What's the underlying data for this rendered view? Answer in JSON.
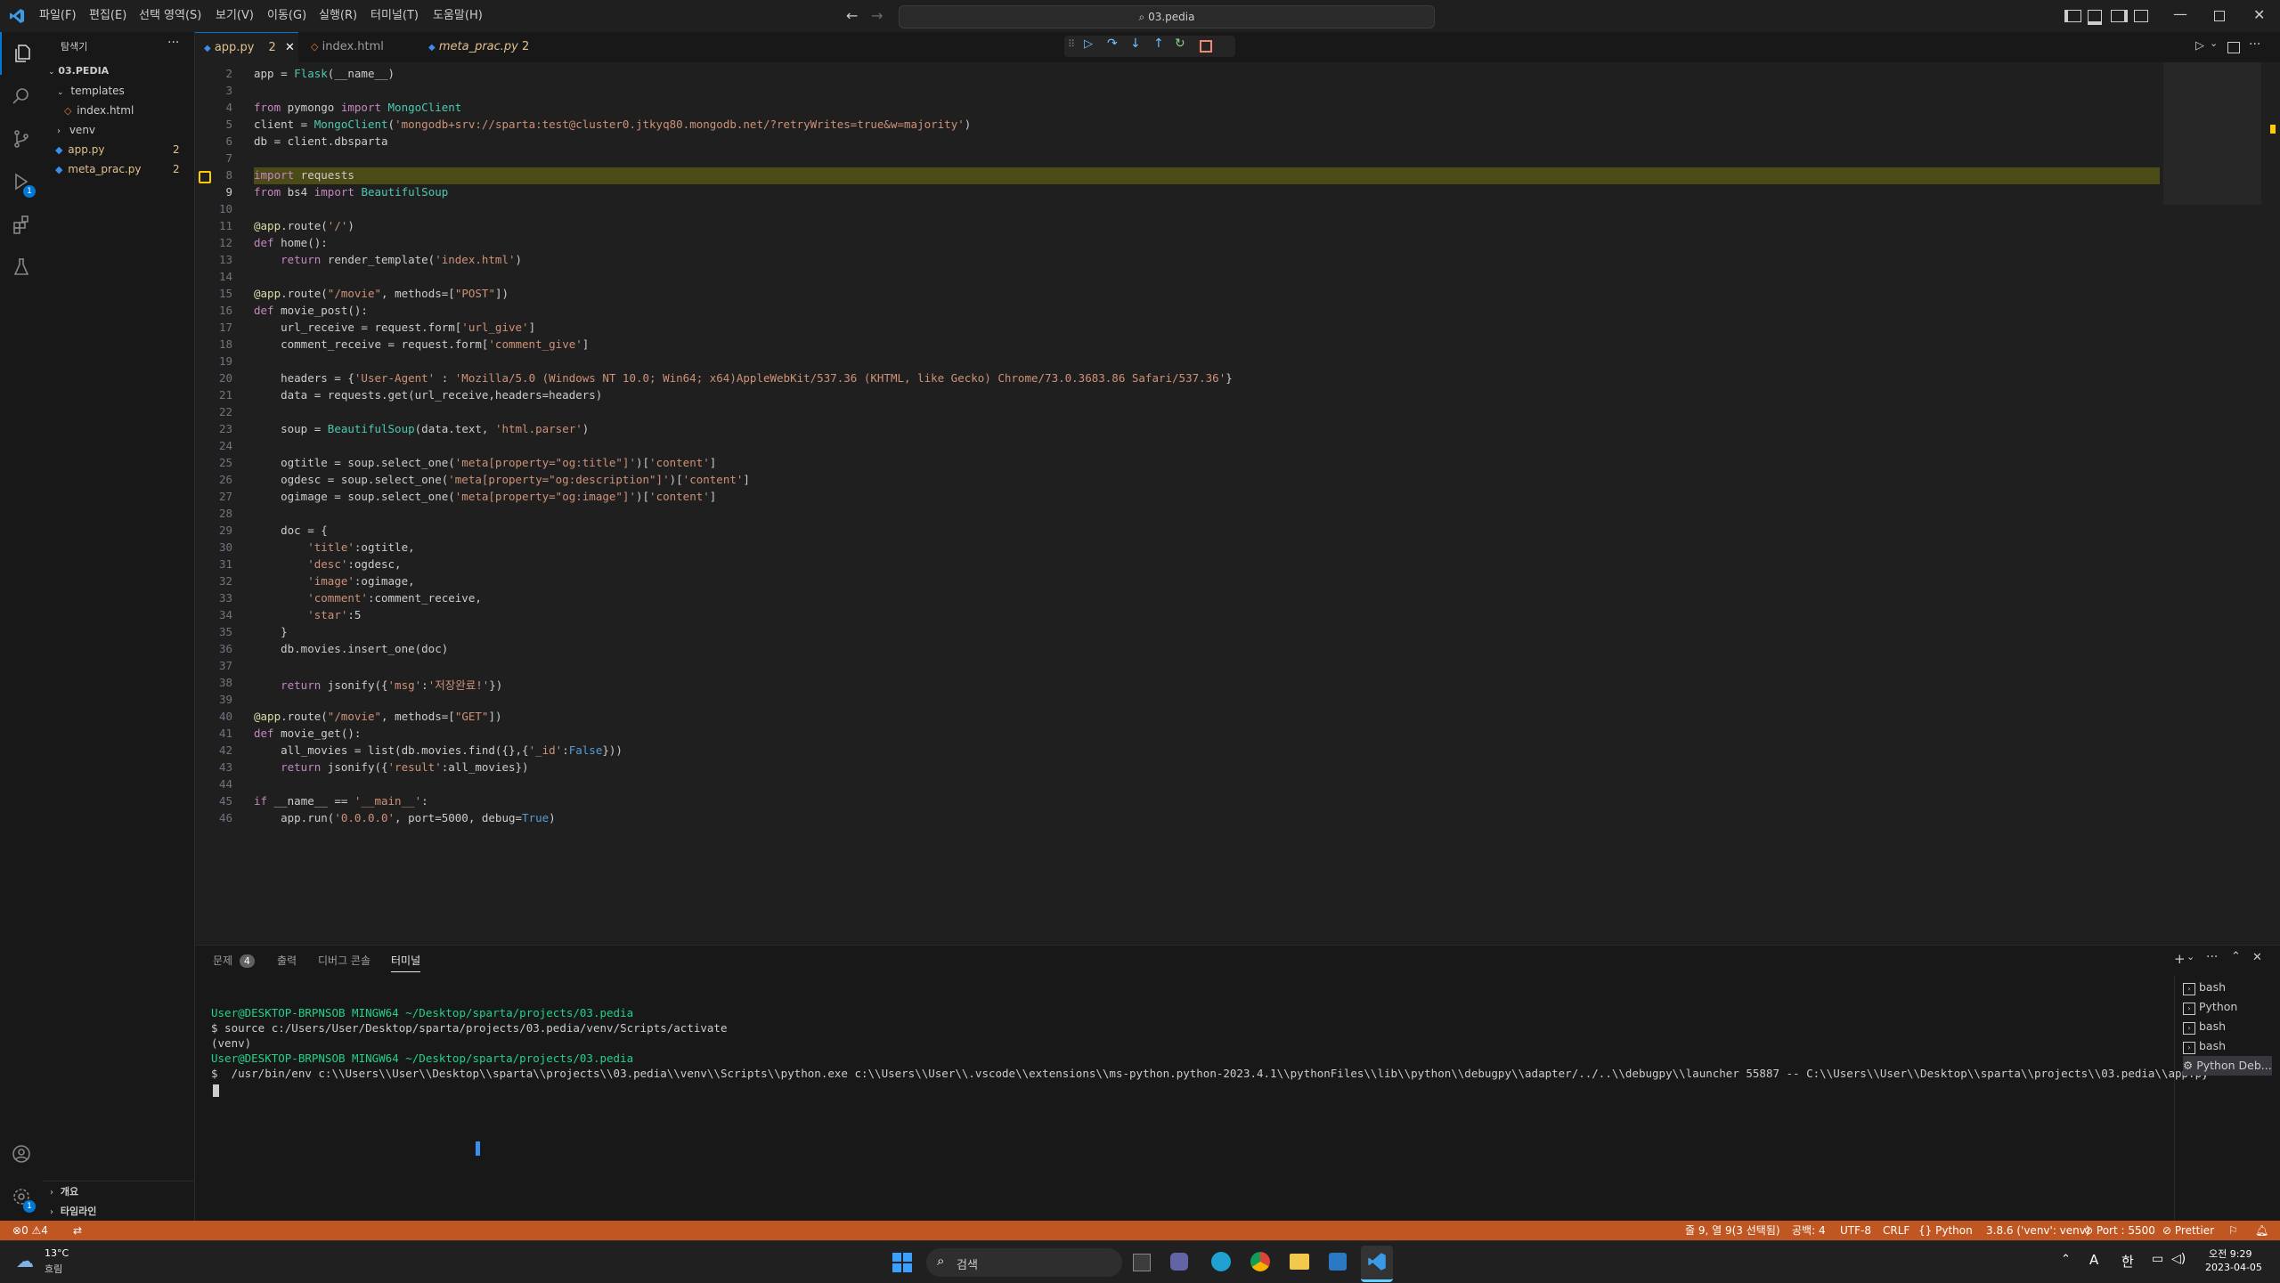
{
  "colors": {
    "accent": "#0078d4",
    "statusbar": "#c05621",
    "modified": "#e2c08d",
    "breakpoint": "#ffcc00"
  },
  "menu": [
    "파일(F)",
    "편집(E)",
    "선택 영역(S)",
    "보기(V)",
    "이동(G)",
    "실행(R)",
    "터미널(T)",
    "도움말(H)"
  ],
  "search": {
    "label": "03.pedia"
  },
  "sidebar": {
    "title": "탐색기",
    "folder": "03.PEDIA",
    "items": [
      {
        "label": "templates",
        "type": "folder-open"
      },
      {
        "label": "index.html",
        "type": "html"
      },
      {
        "label": "venv",
        "type": "folder"
      },
      {
        "label": "app.py",
        "type": "py",
        "badge": "2"
      },
      {
        "label": "meta_prac.py",
        "type": "py",
        "badge": "2"
      }
    ],
    "outline": "개요",
    "timeline": "타임라인"
  },
  "tabs": [
    {
      "label": "app.py",
      "badge": "2",
      "active": true
    },
    {
      "label": "index.html",
      "badge": ""
    },
    {
      "label": "meta_prac.py",
      "badge": "2"
    }
  ],
  "code": [
    {
      "n": "2",
      "t": "app = Flask(__name__)"
    },
    {
      "n": "3",
      "t": ""
    },
    {
      "n": "4",
      "t": "from pymongo import MongoClient"
    },
    {
      "n": "5",
      "t": "client = MongoClient('mongodb+srv://sparta:test@cluster0.jtkyq80.mongodb.net/?retryWrites=true&w=majority')"
    },
    {
      "n": "6",
      "t": "db = client.dbsparta"
    },
    {
      "n": "7",
      "t": ""
    },
    {
      "n": "8",
      "t": "import requests"
    },
    {
      "n": "9",
      "t": "from bs4 import BeautifulSoup"
    },
    {
      "n": "10",
      "t": ""
    },
    {
      "n": "11",
      "t": "@app.route('/')"
    },
    {
      "n": "12",
      "t": "def home():"
    },
    {
      "n": "13",
      "t": "    return render_template('index.html')"
    },
    {
      "n": "14",
      "t": ""
    },
    {
      "n": "15",
      "t": "@app.route(\"/movie\", methods=[\"POST\"])"
    },
    {
      "n": "16",
      "t": "def movie_post():"
    },
    {
      "n": "17",
      "t": "    url_receive = request.form['url_give']"
    },
    {
      "n": "18",
      "t": "    comment_receive = request.form['comment_give']"
    },
    {
      "n": "19",
      "t": ""
    },
    {
      "n": "20",
      "t": "    headers = {'User-Agent' : 'Mozilla/5.0 (Windows NT 10.0; Win64; x64)AppleWebKit/537.36 (KHTML, like Gecko) Chrome/73.0.3683.86 Safari/537.36'}"
    },
    {
      "n": "21",
      "t": "    data = requests.get(url_receive,headers=headers)"
    },
    {
      "n": "22",
      "t": ""
    },
    {
      "n": "23",
      "t": "    soup = BeautifulSoup(data.text, 'html.parser')"
    },
    {
      "n": "24",
      "t": ""
    },
    {
      "n": "25",
      "t": "    ogtitle = soup.select_one('meta[property=\"og:title\"]')['content']"
    },
    {
      "n": "26",
      "t": "    ogdesc = soup.select_one('meta[property=\"og:description\"]')['content']"
    },
    {
      "n": "27",
      "t": "    ogimage = soup.select_one('meta[property=\"og:image\"]')['content']"
    },
    {
      "n": "28",
      "t": ""
    },
    {
      "n": "29",
      "t": "    doc = {"
    },
    {
      "n": "30",
      "t": "        'title':ogtitle,"
    },
    {
      "n": "31",
      "t": "        'desc':ogdesc,"
    },
    {
      "n": "32",
      "t": "        'image':ogimage,"
    },
    {
      "n": "33",
      "t": "        'comment':comment_receive,"
    },
    {
      "n": "34",
      "t": "        'star':5"
    },
    {
      "n": "35",
      "t": "    }"
    },
    {
      "n": "36",
      "t": "    db.movies.insert_one(doc)"
    },
    {
      "n": "37",
      "t": ""
    },
    {
      "n": "38",
      "t": "    return jsonify({'msg':'저장완료!'})"
    },
    {
      "n": "39",
      "t": ""
    },
    {
      "n": "40",
      "t": "@app.route(\"/movie\", methods=[\"GET\"])"
    },
    {
      "n": "41",
      "t": "def movie_get():"
    },
    {
      "n": "42",
      "t": "    all_movies = list(db.movies.find({},{'_id':False}))"
    },
    {
      "n": "43",
      "t": "    return jsonify({'result':all_movies})"
    },
    {
      "n": "44",
      "t": ""
    },
    {
      "n": "45",
      "t": "if __name__ == '__main__':"
    },
    {
      "n": "46",
      "t": "    app.run('0.0.0.0', port=5000, debug=True)"
    }
  ],
  "panel": {
    "tabs": [
      {
        "label": "문제",
        "badge": "4"
      },
      {
        "label": "출력"
      },
      {
        "label": "디버그 콘솔"
      },
      {
        "label": "터미널",
        "active": true
      }
    ],
    "terminal": [
      "User@DESKTOP-BRPNSOB MINGW64 ~/Desktop/sparta/projects/03.pedia",
      "$ source c:/Users/User/Desktop/sparta/projects/03.pedia/venv/Scripts/activate",
      "(venv)",
      "User@DESKTOP-BRPNSOB MINGW64 ~/Desktop/sparta/projects/03.pedia",
      "$  /usr/bin/env c:\\\\Users\\\\User\\\\Desktop\\\\sparta\\\\projects\\\\03.pedia\\\\venv\\\\Scripts\\\\python.exe c:\\\\Users\\\\User\\\\.vscode\\\\extensions\\\\ms-python.python-2023.4.1\\\\pythonFiles\\\\lib\\\\python\\\\debugpy\\\\adapter/../..\\\\debugpy\\\\launcher 55887 -- C:\\\\Users\\\\User\\\\Desktop\\\\sparta\\\\projects\\\\03.pedia\\\\app.py"
    ],
    "terminals": [
      "bash",
      "Python",
      "bash",
      "bash",
      "Python Deb..."
    ]
  },
  "status": {
    "errors": "0",
    "warnings": "4",
    "position": "줄 9, 열 9(3 선택됨)",
    "spaces": "공백: 4",
    "encoding": "UTF-8",
    "eol": "CRLF",
    "language": "Python",
    "interpreter": "3.8.6 ('venv': venv)",
    "port": "Port : 5500",
    "prettier": "Prettier"
  },
  "taskbar": {
    "temp": "13°C",
    "weather": "흐림",
    "search": "검색",
    "ime": "한",
    "ime_a": "A",
    "time": "오전 9:29",
    "date": "2023-04-05"
  }
}
